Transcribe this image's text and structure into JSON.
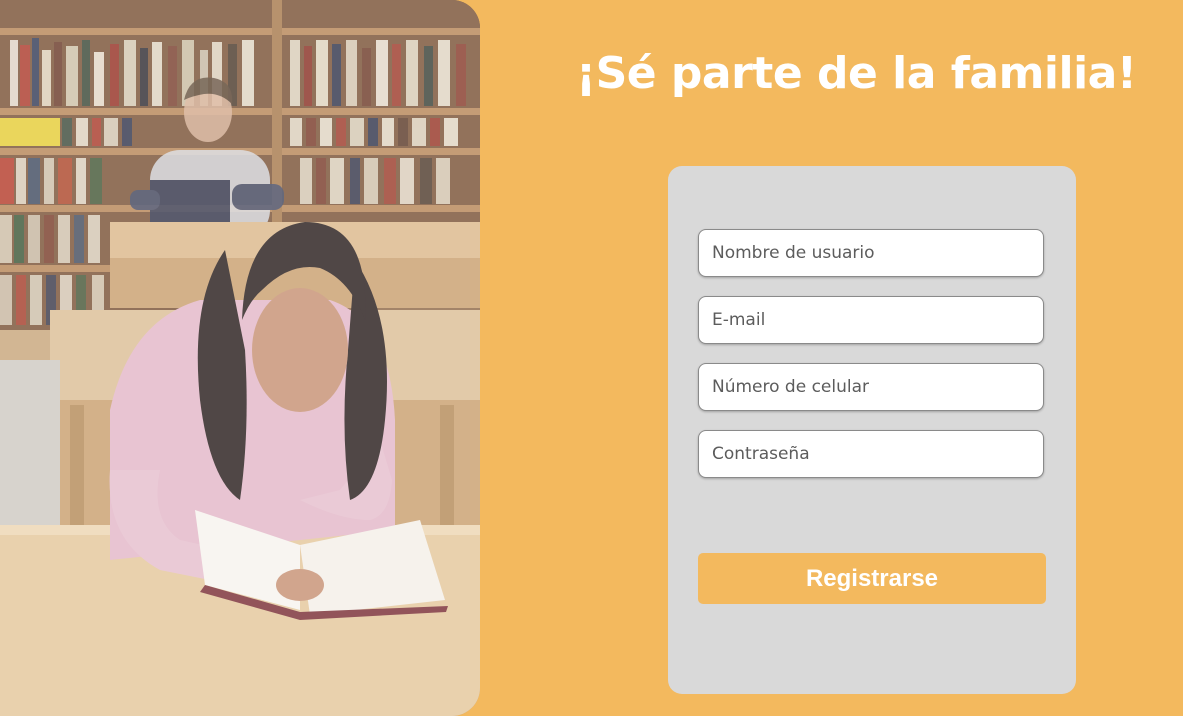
{
  "colors": {
    "background": "#f3b95e",
    "card": "#d9d9d9",
    "button": "#f3b95e",
    "heading_text": "#ffffff"
  },
  "hero_image": {
    "subject": "students-reading-in-library"
  },
  "heading": "¡Sé parte de la familia!",
  "form": {
    "username_placeholder": "Nombre de usuario",
    "email_placeholder": "E-mail",
    "phone_placeholder": "Número de celular",
    "password_placeholder": "Contraseña",
    "submit_label": "Registrarse"
  }
}
